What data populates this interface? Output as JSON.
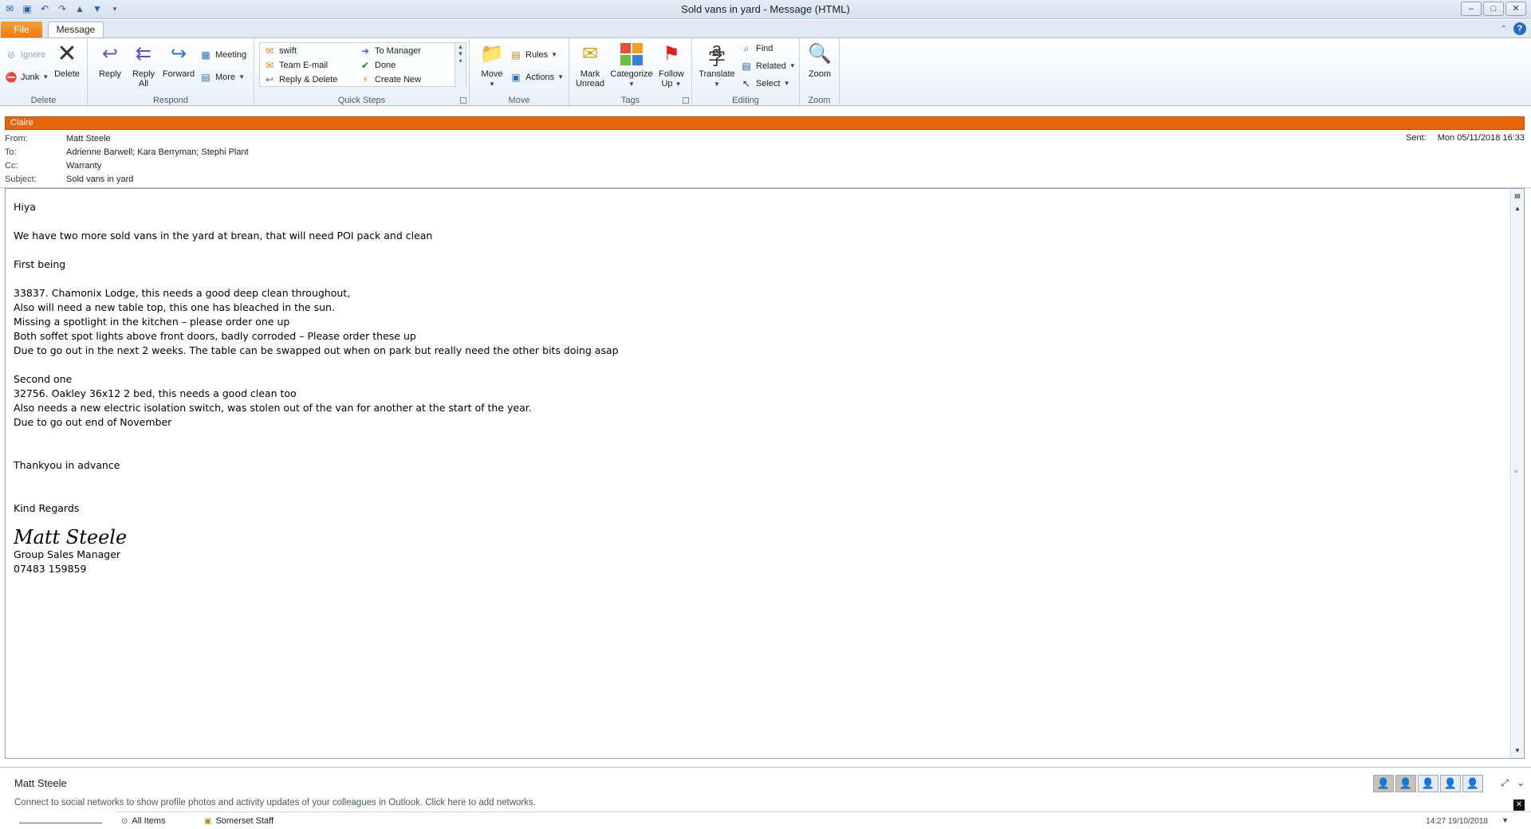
{
  "window": {
    "title": "Sold vans in yard  -  Message (HTML)",
    "controls": [
      "–",
      "□",
      "✕"
    ]
  },
  "tabs": {
    "file": "File",
    "message": "Message"
  },
  "ribbon": {
    "delete": {
      "label": "Delete",
      "ignore": "Ignore",
      "junk": "Junk",
      "delete": "Delete"
    },
    "respond": {
      "label": "Respond",
      "reply": "Reply",
      "reply_all_1": "Reply",
      "reply_all_2": "All",
      "forward": "Forward",
      "meeting": "Meeting",
      "more": "More"
    },
    "quick_steps": {
      "label": "Quick Steps",
      "items": [
        "swift",
        "To Manager",
        "Team E-mail",
        "Done",
        "Reply & Delete",
        "Create New"
      ]
    },
    "move": {
      "label": "Move",
      "move": "Move",
      "rules": "Rules",
      "actions": "Actions"
    },
    "tags": {
      "label": "Tags",
      "mark_unread_1": "Mark",
      "mark_unread_2": "Unread",
      "categorize": "Categorize",
      "follow_up_1": "Follow",
      "follow_up_2": "Up"
    },
    "editing": {
      "label": "Editing",
      "translate": "Translate",
      "find": "Find",
      "related": "Related",
      "select": "Select"
    },
    "zoom": {
      "label": "Zoom",
      "zoom": "Zoom"
    }
  },
  "infobar": {
    "text": "Claire",
    "color": "#e6660e"
  },
  "header": {
    "from_label": "From:",
    "from": "Matt Steele",
    "to_label": "To:",
    "to": "Adrienne Barwell; Kara Berryman; Stephi Plant",
    "cc_label": "Cc:",
    "cc": "Warranty",
    "subject_label": "Subject:",
    "subject": "Sold vans in yard",
    "sent_label": "Sent:",
    "sent": "Mon 05/11/2018 16:33"
  },
  "body": {
    "lines": [
      "Hiya",
      "",
      "We have two more sold vans in the yard at brean, that will need POI pack and clean",
      "",
      "First being",
      "",
      "33837. Chamonix Lodge, this needs a good deep clean throughout,",
      "Also will need a new table top, this one has bleached in the sun.",
      "Missing a spotlight in the kitchen – please order one up",
      "Both soffet spot lights above front doors, badly corroded – Please order these up",
      "Due to go out in the next 2 weeks. The table can be swapped out when on park but really need the other bits doing asap",
      "",
      "Second one",
      "32756. Oakley 36x12 2 bed, this needs a good clean too",
      "Also needs a new electric isolation switch, was stolen out of the van for another at the start of the year.",
      "Due to go out end of November",
      "",
      "",
      "Thankyou in advance",
      "",
      "",
      "Kind Regards"
    ],
    "signature": "Matt Steele",
    "sig_title": "Group Sales Manager",
    "sig_phone": "07483 159859"
  },
  "people_pane": {
    "name": "Matt Steele",
    "message": "Connect to social networks to show profile photos and activity updates of your colleagues in Outlook. Click here to add networks."
  },
  "bottom": {
    "all_items": "All Items",
    "folder": "Somerset Staff",
    "time": "14:27  19/10/2018"
  },
  "icons": {
    "save": "save-icon",
    "undo": "undo-icon",
    "redo": "redo-icon",
    "up": "up-arrow-icon",
    "down": "down-arrow-icon"
  },
  "colors": {
    "file_tab": "#e77c12",
    "accent": "#2a6ac2"
  }
}
